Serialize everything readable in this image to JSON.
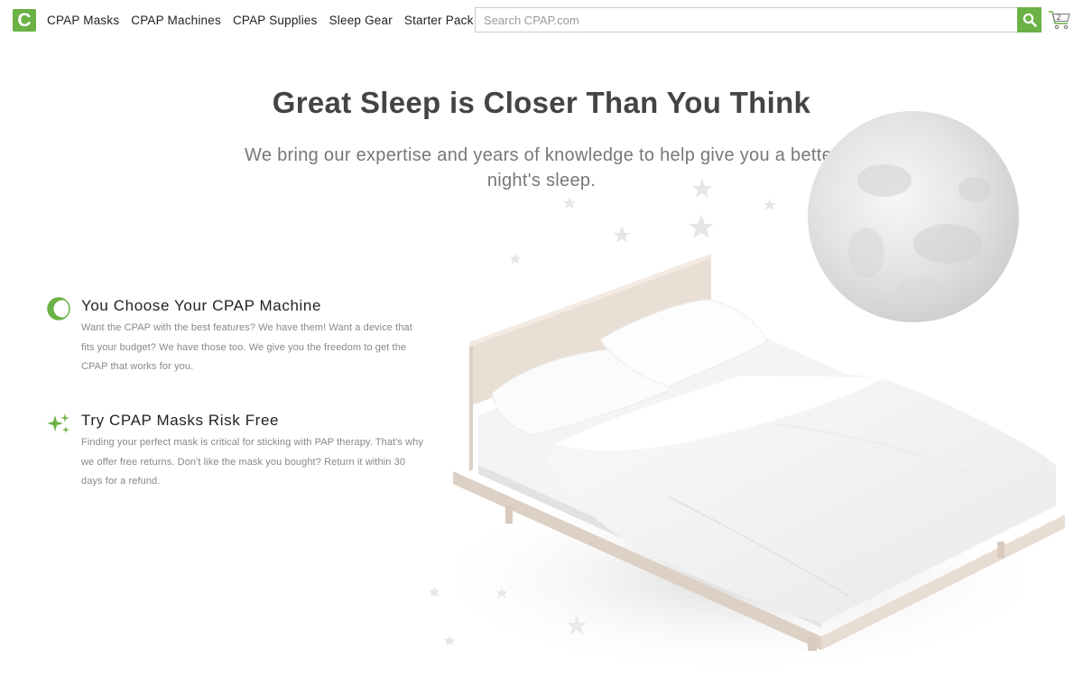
{
  "header": {
    "logo_letter": "C",
    "nav": [
      {
        "label": "CPAP Masks"
      },
      {
        "label": "CPAP Machines"
      },
      {
        "label": "CPAP Supplies"
      },
      {
        "label": "Sleep Gear"
      },
      {
        "label": "Starter Pack"
      }
    ],
    "search": {
      "placeholder": "Search CPAP.com",
      "value": ""
    },
    "cart": {
      "count": "2"
    }
  },
  "hero": {
    "title": "Great Sleep is Closer Than You Think",
    "subtitle": "We bring our expertise and years of knowledge to help give you a better night's sleep."
  },
  "features": [
    {
      "icon": "crescent-moon-icon",
      "title": "You Choose Your CPAP Machine",
      "text": "Want the CPAP with the best features? We have them! Want a device that fits your budget? We have those too. We give you the freedom to get the CPAP that works for you."
    },
    {
      "icon": "sparkle-icon",
      "title": "Try CPAP Masks Risk Free",
      "text": "Finding your perfect mask is critical for sticking with PAP therapy. That's why we offer free returns. Don't like the mask you bought? Return it within 30 days for a refund."
    }
  ],
  "colors": {
    "brand_green": "#6bb245",
    "heading": "#444444",
    "body_text": "#888888"
  }
}
